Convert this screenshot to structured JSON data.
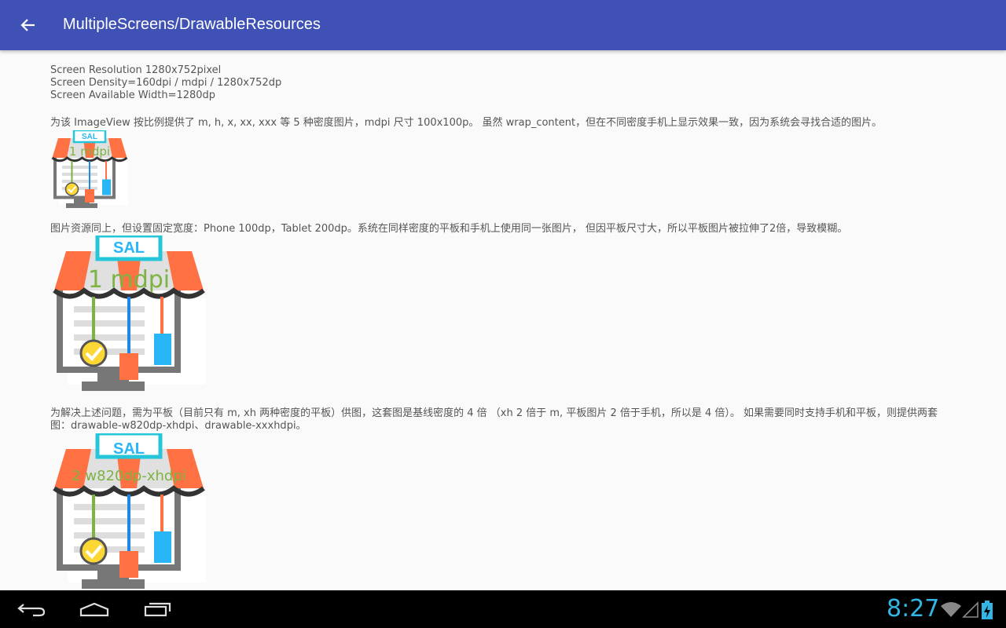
{
  "appbar": {
    "title": "MultipleScreens/DrawableResources",
    "back_icon": "arrow-back-icon",
    "color": "#3f51b5"
  },
  "info": {
    "line1": "Screen Resolution 1280x752pixel",
    "line2": "Screen Density=160dpi / mdpi / 1280x752dp",
    "line3": "Screen Available Width=1280dp"
  },
  "sections": [
    {
      "text": "为该 ImageView 按比例提供了 m, h, x, xx, xxx 等 5 种密度图片，mdpi 尺寸 100x100p。 虽然 wrap_content，但在不同密度手机上显示效果一致，因为系统会寻找合适的图片。",
      "image_label": "1 mdpi",
      "sign": "SAL"
    },
    {
      "text": "图片资源同上，但设置固定宽度：Phone 100dp，Tablet 200dp。系统在同样密度的平板和手机上使用同一张图片， 但因平板尺寸大，所以平板图片被拉伸了2倍，导致模糊。",
      "image_label": "1 mdpi",
      "sign": "SAL"
    },
    {
      "text": "为解决上述问题，需为平板（目前只有 m, xh 两种密度的平板）供图，这套图是基线密度的 4 倍 （xh 2 倍于 m, 平板图片 2 倍于手机，所以是 4 倍）。 如果需要同时支持手机和平板，则提供两套图：drawable-w820dp-xhdpi、drawable-xxxhdpi。",
      "image_label": "2  w820dp-xhdpi",
      "sign": "SAL"
    }
  ],
  "navbar": {
    "back_icon": "nav-back-icon",
    "home_icon": "nav-home-icon",
    "recents_icon": "nav-recents-icon"
  },
  "status": {
    "time": "8:27",
    "wifi_icon": "wifi-icon",
    "signal_icon": "signal-icon",
    "battery_icon": "battery-charging-icon"
  }
}
